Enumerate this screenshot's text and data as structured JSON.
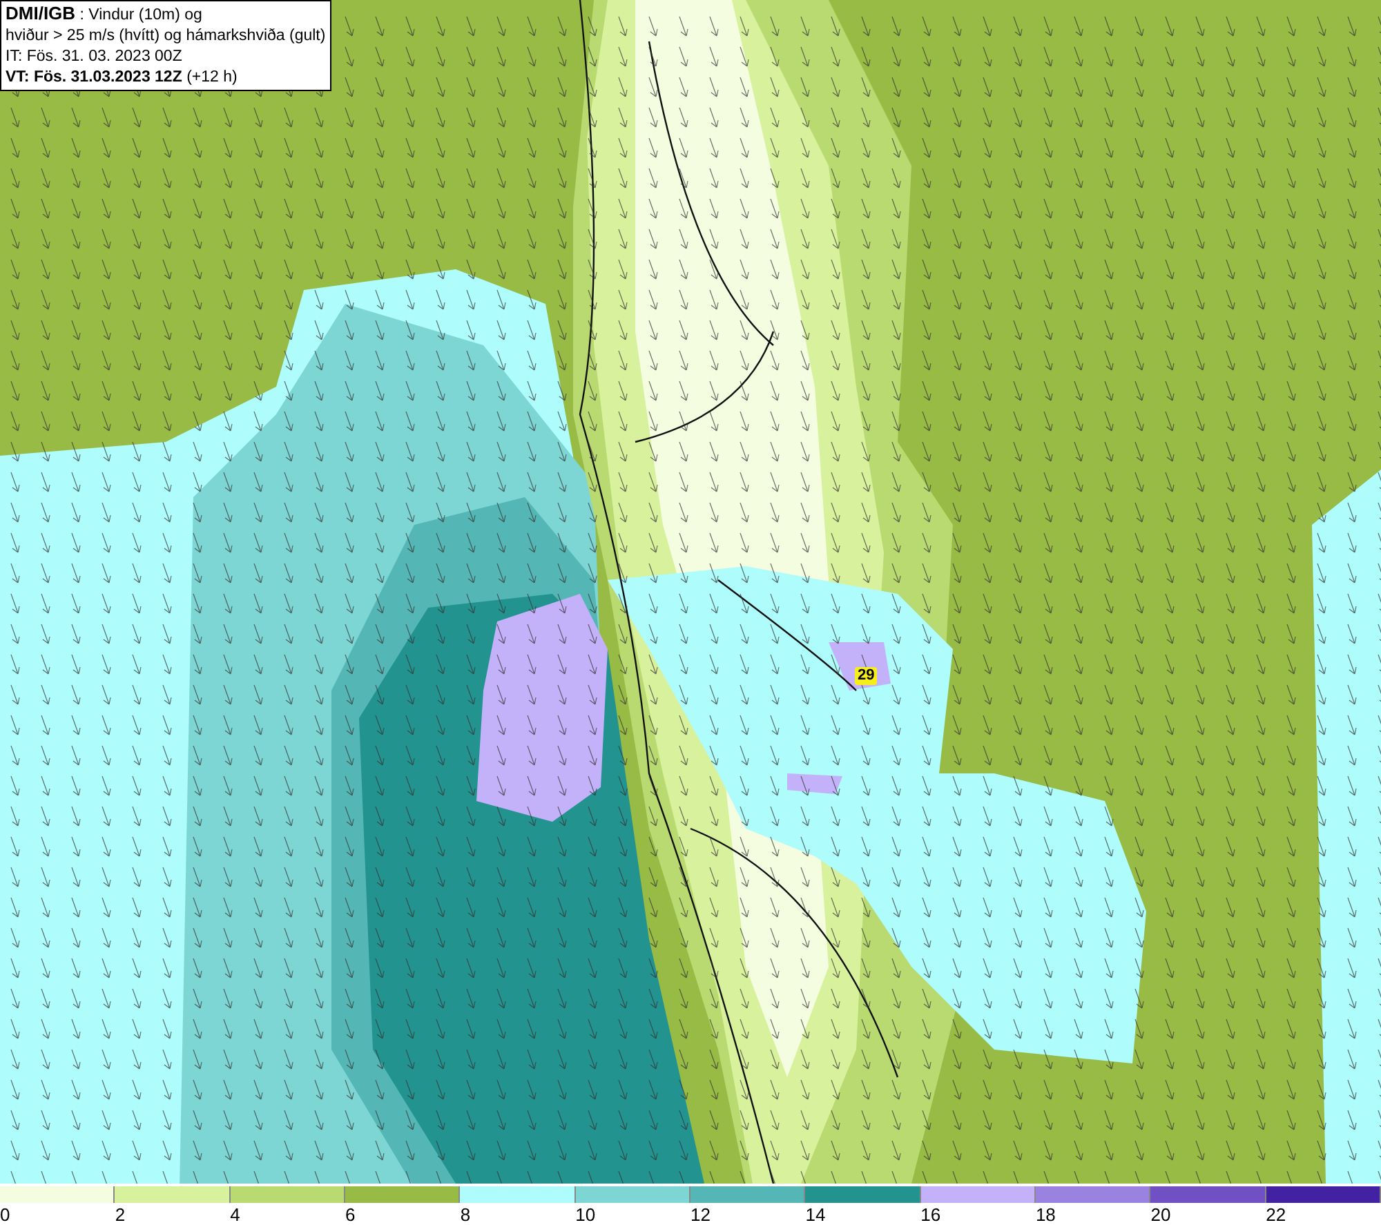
{
  "title_box": {
    "source": "DMI/IGB",
    "title_rest": ": Vindur (10m) og",
    "line2": "hviður > 25 m/s (hvítt) og hámarkshviða (gult)",
    "issue_time": "IT: Fös. 31. 03. 2023 00Z",
    "valid_time": "VT: Fös. 31.03.2023 12Z",
    "offset": "(+12 h)"
  },
  "gust_marker": {
    "value": "29"
  },
  "legend": [
    {
      "label": "0",
      "color": "#f5fde0"
    },
    {
      "label": "2",
      "color": "#d8f19c"
    },
    {
      "label": "4",
      "color": "#b8da70"
    },
    {
      "label": "6",
      "color": "#98bb45"
    },
    {
      "label": "8",
      "color": "#aefcfc"
    },
    {
      "label": "10",
      "color": "#7dd6d4"
    },
    {
      "label": "12",
      "color": "#55b7b5"
    },
    {
      "label": "14",
      "color": "#239390"
    },
    {
      "label": "16",
      "color": "#c3b2fa"
    },
    {
      "label": "18",
      "color": "#9a82e0"
    },
    {
      "label": "20",
      "color": "#7150c3"
    },
    {
      "label": "22",
      "color": "#4221a2"
    }
  ]
}
